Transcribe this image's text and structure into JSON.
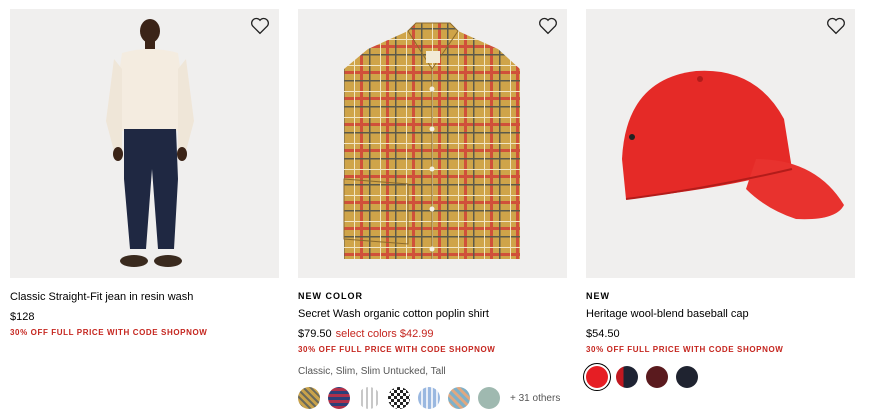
{
  "products": [
    {
      "tag": "",
      "name": "Classic Straight-Fit jean in resin wash",
      "price": "$128",
      "sale_price": "",
      "promo": "30% OFF FULL PRICE WITH CODE SHOPNOW",
      "image_icon": "model-in-jeans-photo",
      "favorite_icon": "heart-icon"
    },
    {
      "tag": "NEW COLOR",
      "name": "Secret Wash organic cotton poplin shirt",
      "price": "$79.50",
      "sale_price": "select colors $42.99",
      "promo": "30% OFF FULL PRICE WITH CODE SHOPNOW",
      "fits": "Classic, Slim, Slim Untucked, Tall",
      "swatches": [
        "#c9a24a",
        "#b0304a",
        "#d9d9d9",
        "#2a2a2a",
        "#9ab8e0",
        "#7fb0c8",
        "#9fb9b0"
      ],
      "more_colors": "+ 31 others",
      "image_icon": "plaid-shirt-photo",
      "favorite_icon": "heart-icon"
    },
    {
      "tag": "NEW",
      "name": "Heritage wool-blend baseball cap",
      "price": "$54.50",
      "sale_price": "",
      "promo": "30% OFF FULL PRICE WITH CODE SHOPNOW",
      "swatches": [
        "#e61e24",
        "#1e2333",
        "#5a1a1e",
        "#1f2330"
      ],
      "image_icon": "red-cap-photo",
      "favorite_icon": "heart-icon"
    }
  ],
  "colors": {
    "promo_red": "#c5261f",
    "image_bg": "#f0efee"
  }
}
